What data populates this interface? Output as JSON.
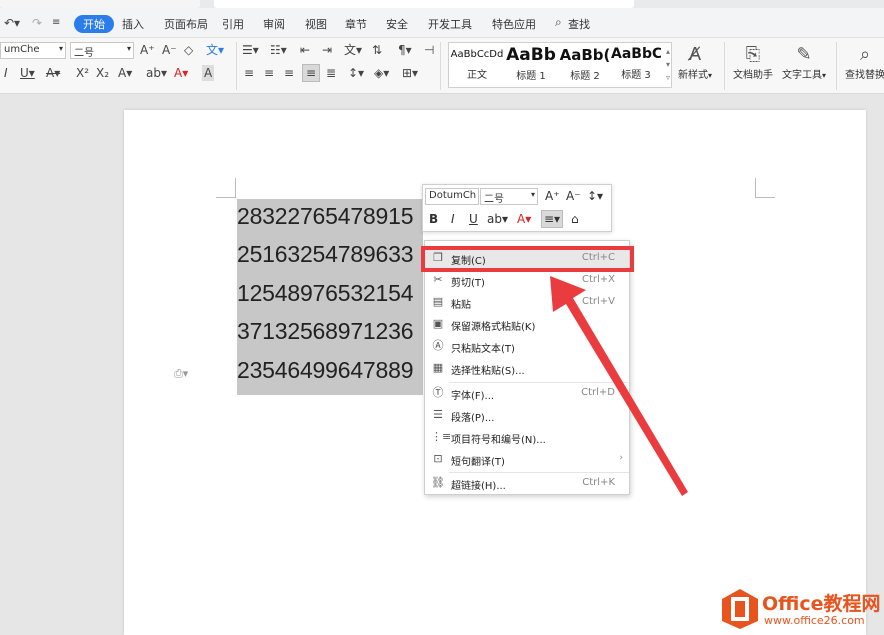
{
  "menu": {
    "tabs": [
      "开始",
      "插入",
      "页面布局",
      "引用",
      "审阅",
      "视图",
      "章节",
      "安全",
      "开发工具",
      "特色应用"
    ],
    "active_tab": "开始",
    "search_label": "查找"
  },
  "ribbon": {
    "font_name": "umChe",
    "font_size": "二号",
    "styles": [
      {
        "sample": "AaBbCcDd",
        "name": "正文"
      },
      {
        "sample": "AaBb",
        "name": "标题 1"
      },
      {
        "sample": "AaBb(",
        "name": "标题 2"
      },
      {
        "sample": "AaBbC",
        "name": "标题 3"
      }
    ],
    "new_style": "新样式",
    "doc_helper": "文档助手",
    "text_tools": "文字工具",
    "find_replace": "查找替换"
  },
  "document": {
    "lines": [
      "28322765478915",
      "25163254789633",
      "12548976532154",
      "37132568971236",
      "23546499647889"
    ]
  },
  "mini_toolbar": {
    "font_name": "DotumCh",
    "font_size": "二号"
  },
  "context_menu": {
    "items": [
      {
        "icon": "copy-icon",
        "label": "复制(C)",
        "shortcut": "Ctrl+C"
      },
      {
        "icon": "cut-icon",
        "label": "剪切(T)",
        "shortcut": "Ctrl+X"
      },
      {
        "icon": "paste-icon",
        "label": "粘贴",
        "shortcut": "Ctrl+V"
      },
      {
        "icon": "keep-format-icon",
        "label": "保留源格式粘贴(K)",
        "shortcut": ""
      },
      {
        "icon": "paste-text-icon",
        "label": "只粘贴文本(T)",
        "shortcut": ""
      },
      {
        "icon": "paste-special-icon",
        "label": "选择性粘贴(S)...",
        "shortcut": ""
      },
      {
        "icon": "font-icon",
        "label": "字体(F)...",
        "shortcut": "Ctrl+D"
      },
      {
        "icon": "paragraph-icon",
        "label": "段落(P)...",
        "shortcut": ""
      },
      {
        "icon": "bullets-icon",
        "label": "项目符号和编号(N)...",
        "shortcut": ""
      },
      {
        "icon": "translate-icon",
        "label": "短句翻译(T)",
        "shortcut": ""
      },
      {
        "icon": "link-icon",
        "label": "超链接(H)...",
        "shortcut": "Ctrl+K"
      }
    ]
  },
  "watermark": {
    "brand": "Office教程网",
    "url": "www.office26.com"
  },
  "colors": {
    "accent": "#2b7de9",
    "highlight": "#ea3b3f",
    "selection": "#c7c7c7",
    "logo": "#e8541e"
  }
}
